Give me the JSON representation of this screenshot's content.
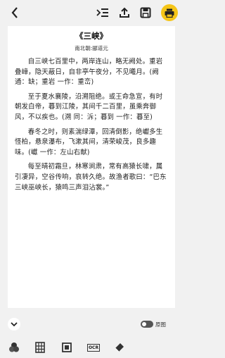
{
  "toolbar": {
    "back_icon": "back-arrow",
    "icons": [
      "indent-list-icon",
      "upload-icon",
      "save-icon",
      "print-icon"
    ],
    "print_color": "#f5c518"
  },
  "article": {
    "title": "《三峡》",
    "author": "南北朝:郦道元",
    "paragraphs": [
      "自三峡七百里中，两岸连山，略无阙处。重岩叠嶂，隐天蔽日，自非亭午夜分，不见曦月。(阙通：缺；重岩 一作：重峦)",
      "至于夏水襄陵，沿溯阻绝。或王命急宣，有时朝发白帝，暮到江陵，其间千二百里，虽乘奔御风，不以疾也。(溯 同：泝；暮到 一作：暮至)",
      "春冬之时，则素湍绿潭，回清倒影，绝巘多生怪柏，悬泉瀑布，飞漱其间，清荣峻茂，良多趣味。(巘 一作：左山右献)",
      "每至晴初霜旦，林寒涧肃，常有高猿长啸，属引凄异，空谷传响，哀转久绝。故渔者歌曰：“巴东三峡巫峡长，猿鸣三声泪沾裳。”"
    ]
  },
  "controls": {
    "original_label": "原图"
  },
  "bottom": {
    "ocr_label": "OCR",
    "icons": [
      "color-filter-icon",
      "grid-icon",
      "crop-icon",
      "ocr-icon",
      "eraser-icon"
    ]
  }
}
